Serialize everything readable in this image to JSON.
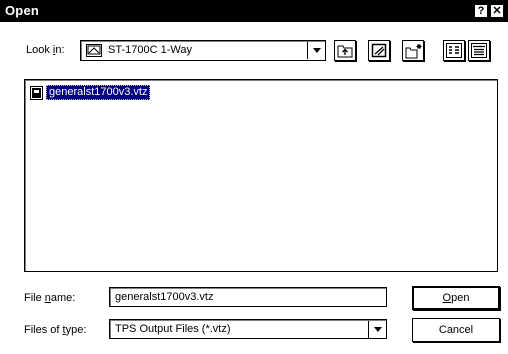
{
  "window": {
    "title": "Open",
    "help_label": "?",
    "close_label": "✕"
  },
  "look_in": {
    "label": "Look in:",
    "mnemonic": "i",
    "value": "ST-1700C 1-Way",
    "icon": "drive-icon"
  },
  "toolbar": {
    "up_icon": "up-folder-icon",
    "desktop_icon": "desktop-icon",
    "new_folder_icon": "new-folder-icon",
    "list_icon": "list-view-icon",
    "details_icon": "details-view-icon"
  },
  "files": [
    {
      "name": "generalst1700v3.vtz",
      "icon": "file-icon",
      "selected": true
    }
  ],
  "file_name": {
    "label": "File name:",
    "mnemonic": "n",
    "value": "generalst1700v3.vtz"
  },
  "file_type": {
    "label": "Files of type:",
    "mnemonic": "t",
    "value": "TPS Output Files (*.vtz)"
  },
  "buttons": {
    "open": "Open",
    "cancel": "Cancel"
  }
}
